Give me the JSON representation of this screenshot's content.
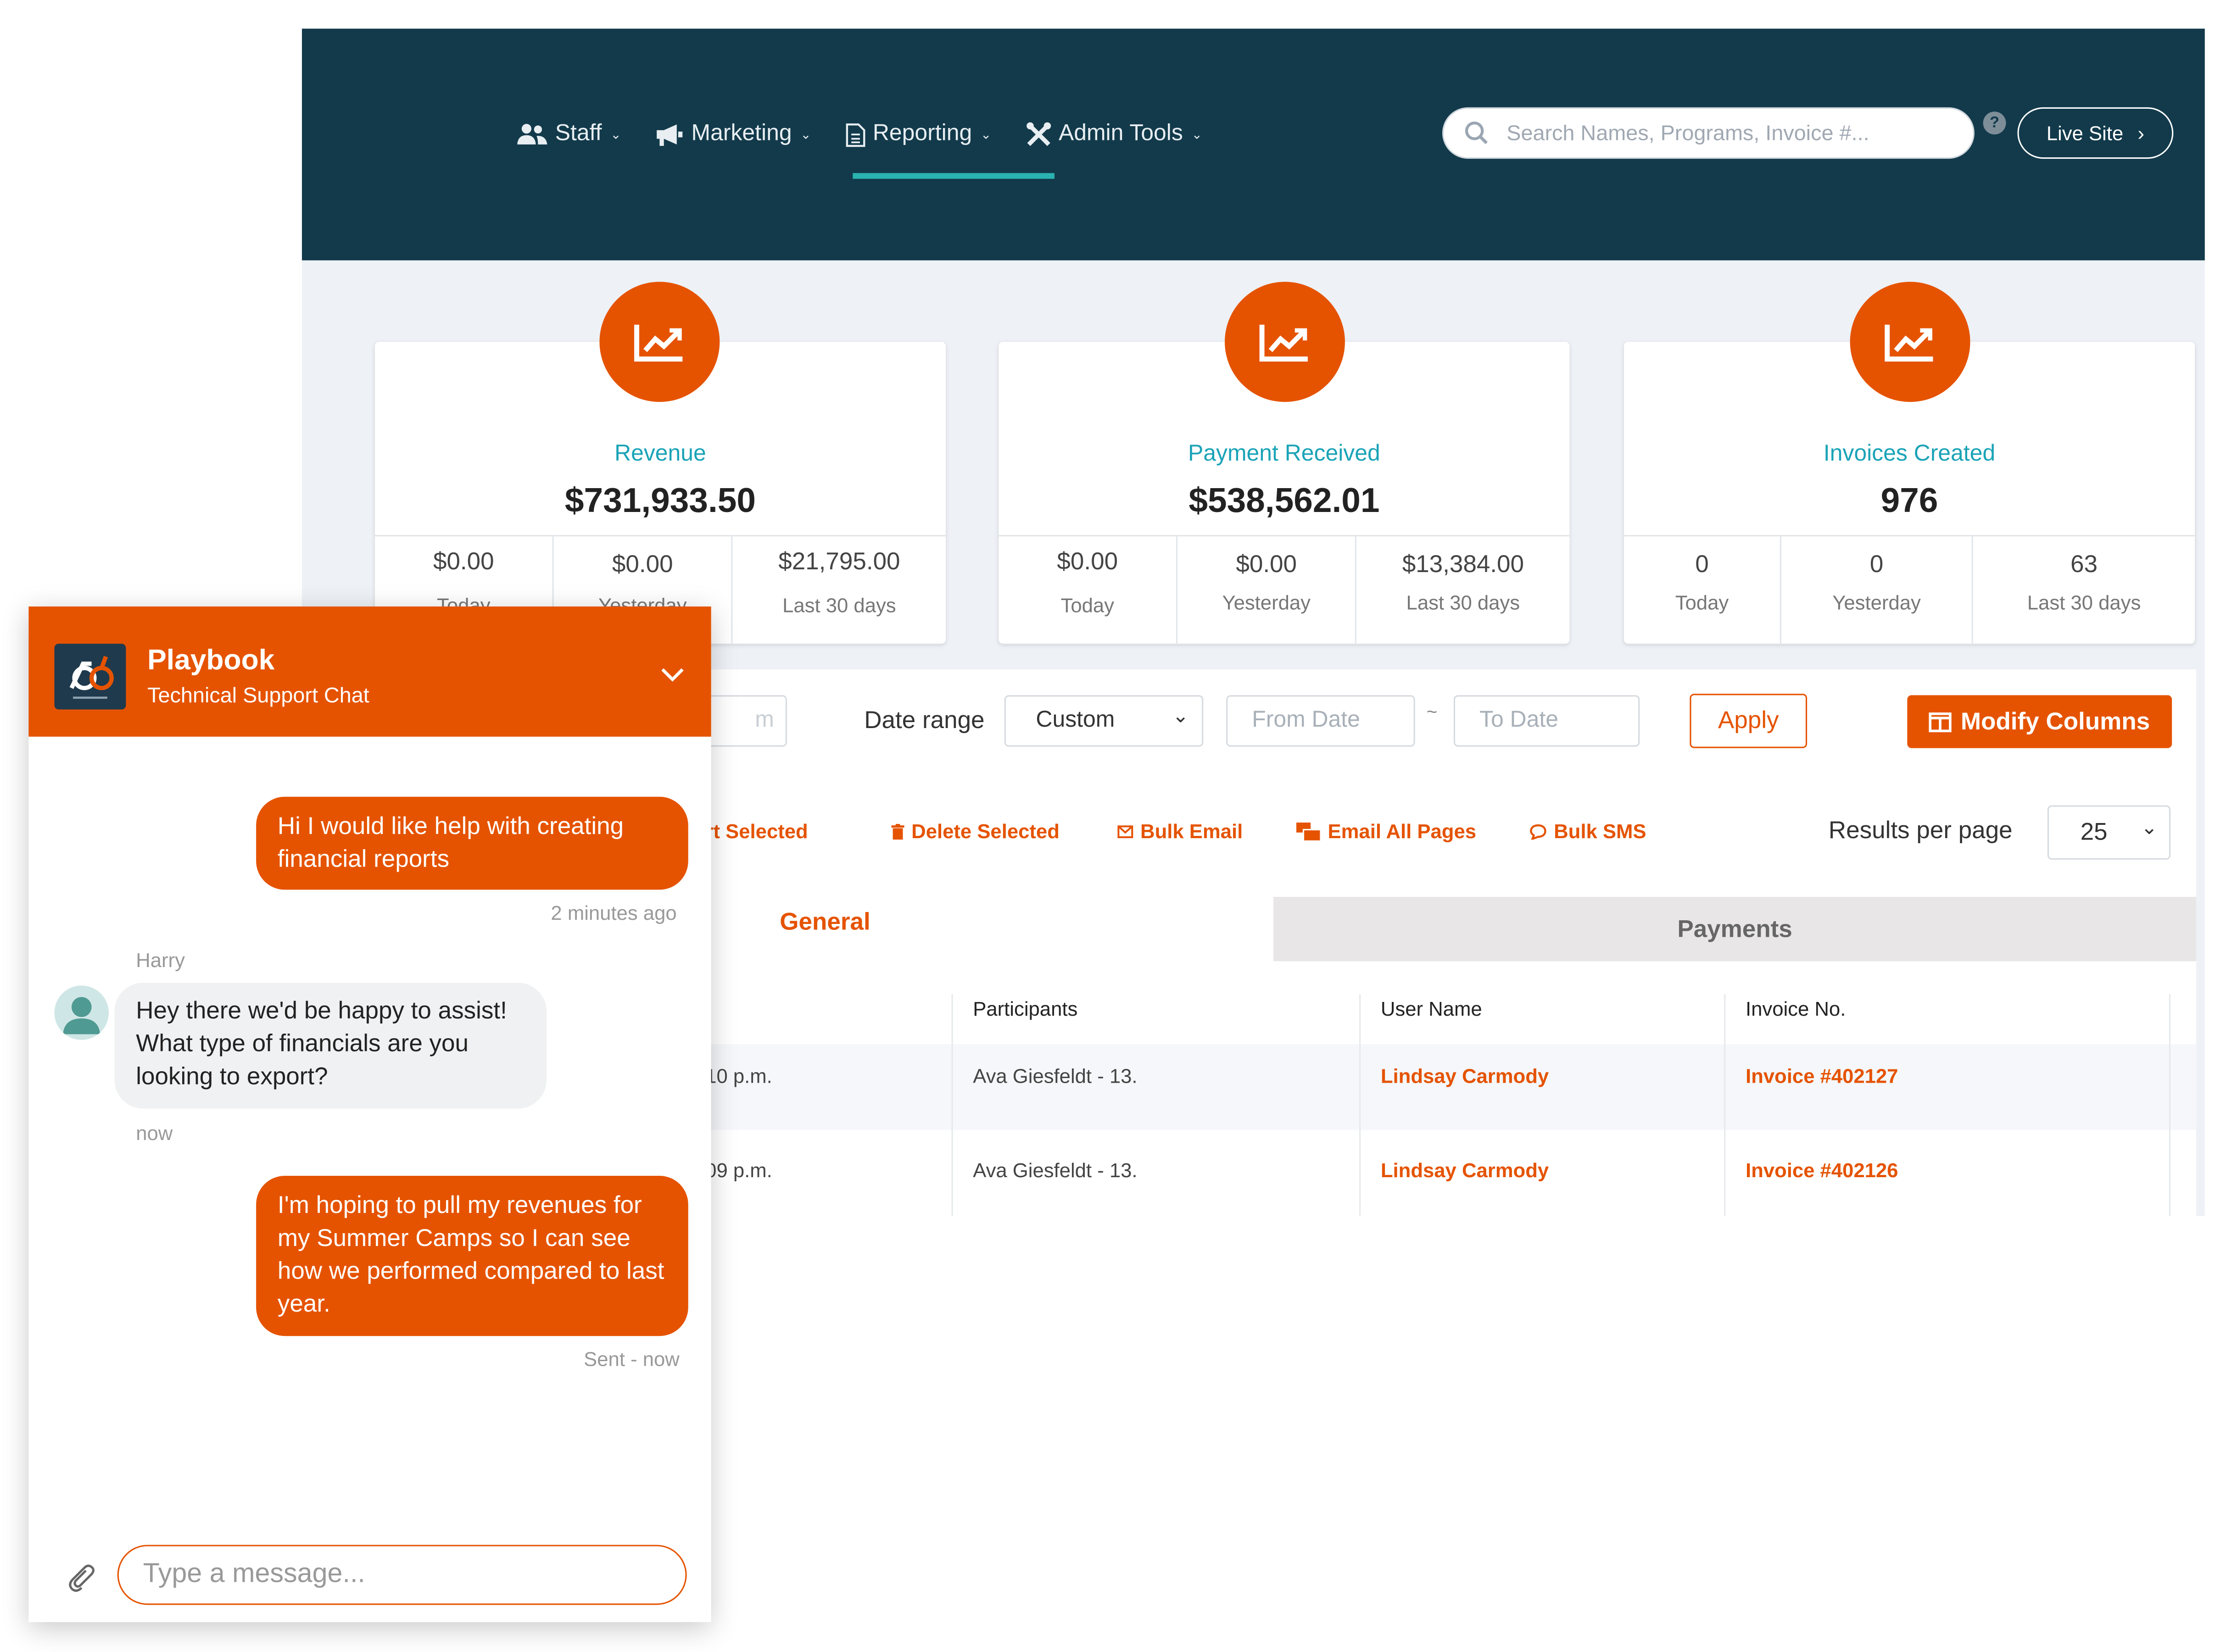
{
  "nav": {
    "items": [
      {
        "label": "Staff",
        "icon": "users-icon"
      },
      {
        "label": "Marketing",
        "icon": "megaphone-icon"
      },
      {
        "label": "Reporting",
        "icon": "document-icon"
      },
      {
        "label": "Admin Tools",
        "icon": "tools-icon"
      }
    ],
    "active": "Reporting"
  },
  "search": {
    "placeholder": "Search Names, Programs, Invoice #..."
  },
  "live_site_label": "Live Site",
  "colors": {
    "brand_orange": "#e55300",
    "nav_bg": "#123a4b",
    "accent_teal": "#2ab3b0",
    "stat_title": "#1aa3b7"
  },
  "stats": [
    {
      "title": "Revenue",
      "value": "$731,933.50",
      "cells": [
        {
          "value": "$0.00",
          "label": "Today"
        },
        {
          "value": "$0.00",
          "label": "Yesterday"
        },
        {
          "value": "$21,795.00",
          "label": "Last 30 days"
        }
      ]
    },
    {
      "title": "Payment Received",
      "value": "$538,562.01",
      "cells": [
        {
          "value": "$0.00",
          "label": "Today"
        },
        {
          "value": "$0.00",
          "label": "Yesterday"
        },
        {
          "value": "$13,384.00",
          "label": "Last 30 days"
        }
      ]
    },
    {
      "title": "Invoices Created",
      "value": "976",
      "cells": [
        {
          "value": "0",
          "label": "Today"
        },
        {
          "value": "0",
          "label": "Yesterday"
        },
        {
          "value": "63",
          "label": "Last 30 days"
        }
      ]
    }
  ],
  "filters": {
    "partial_input_text": "m",
    "date_range_label": "Date range",
    "date_range_value": "Custom",
    "from_placeholder": "From Date",
    "tilde": "~",
    "to_placeholder": "To Date",
    "apply_label": "Apply",
    "modify_columns_label": "Modify Columns"
  },
  "bulk_actions": {
    "export": "port Selected",
    "delete": "Delete Selected",
    "bulk_email": "Bulk Email",
    "email_all": "Email All Pages",
    "bulk_sms": "Bulk SMS"
  },
  "results_per_page": {
    "label": "Results per page",
    "value": "25"
  },
  "tabs": {
    "general": "General",
    "payments": "Payments"
  },
  "table": {
    "headers": {
      "participants": "Participants",
      "user_name": "User Name",
      "invoice": "Invoice No."
    },
    "rows": [
      {
        "time": "10 p.m.",
        "participant": "Ava Giesfeldt - 13.",
        "user": "Lindsay Carmody",
        "invoice": "Invoice #402127"
      },
      {
        "time": "09 p.m.",
        "participant": "Ava Giesfeldt - 13.",
        "user": "Lindsay Carmody",
        "invoice": "Invoice #402126"
      }
    ]
  },
  "chat": {
    "title": "Playbook",
    "subtitle": "Technical Support Chat",
    "messages": [
      {
        "text": "Hi I would like help with creating financial reports",
        "meta": "2 minutes ago"
      },
      {
        "sender": "Harry",
        "text": "Hey there we'd be happy to assist! What type of financials are you looking to export?",
        "meta": "now"
      },
      {
        "text": "I'm hoping to pull my revenues for my Summer Camps so I can see how we performed compared to last year.",
        "meta": "Sent - now"
      }
    ],
    "input_placeholder": "Type a message..."
  }
}
